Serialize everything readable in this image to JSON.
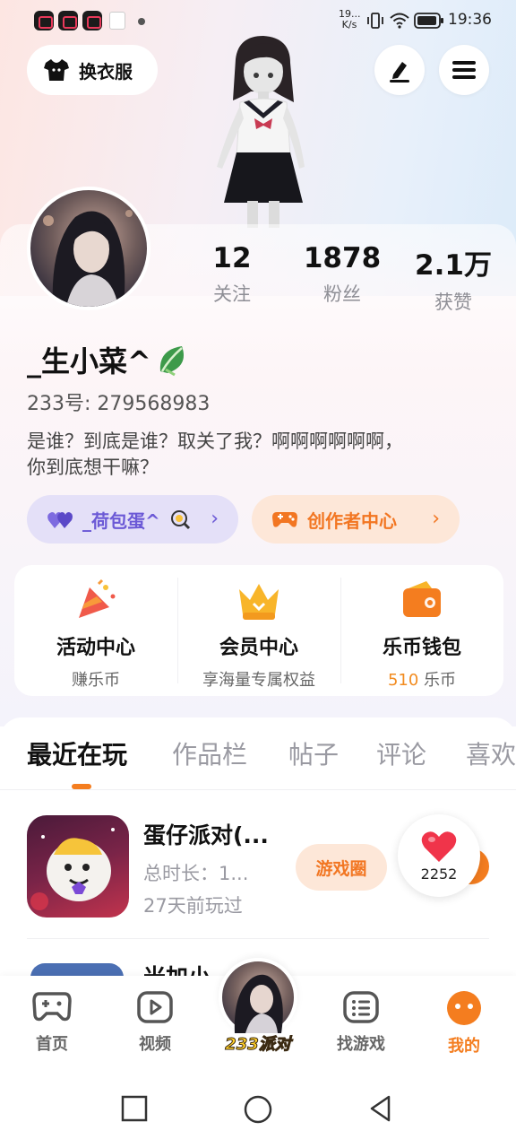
{
  "status_bar": {
    "network_speed": "19...",
    "network_unit": "K/s",
    "time": "19:36"
  },
  "header": {
    "dress_button_label": "换衣服"
  },
  "profile": {
    "stats": [
      {
        "value": "12",
        "label": "关注"
      },
      {
        "value": "1878",
        "label": "粉丝"
      },
      {
        "value": "2.1万",
        "label": "获赞"
      }
    ],
    "nickname": "_生小菜^",
    "uid_label": "233号:",
    "uid_value": "279568983",
    "bio_line1": "是谁？到底是谁？取关了我？啊啊啊啊啊啊，",
    "bio_line2": "你到底想干嘛？",
    "couple_pill_label": "_荷包蛋^",
    "creator_pill_label": "创作者中心"
  },
  "features": [
    {
      "title": "活动中心",
      "sub": "赚乐币"
    },
    {
      "title": "会员中心",
      "sub": "享海量专属权益"
    },
    {
      "title": "乐币钱包",
      "sub_num": "510",
      "sub_unit": "乐币"
    }
  ],
  "tabs": [
    "最近在玩",
    "作品栏",
    "帖子",
    "评论",
    "喜欢"
  ],
  "recent_games": [
    {
      "title": "蛋仔派对(...",
      "duration": "总时长：1...",
      "last_played": "27天前玩过",
      "circle_button": "游戏圈"
    },
    {
      "title": "米加小"
    }
  ],
  "like_fab": {
    "count": "2252"
  },
  "bottom_nav": [
    {
      "label": "首页"
    },
    {
      "label": "视频"
    },
    {
      "label": "233派对"
    },
    {
      "label": "找游戏"
    },
    {
      "label": "我的"
    }
  ],
  "colors": {
    "accent": "#f47d1f",
    "couple_purple": "#6b59d6",
    "like_red": "#f0344a"
  }
}
